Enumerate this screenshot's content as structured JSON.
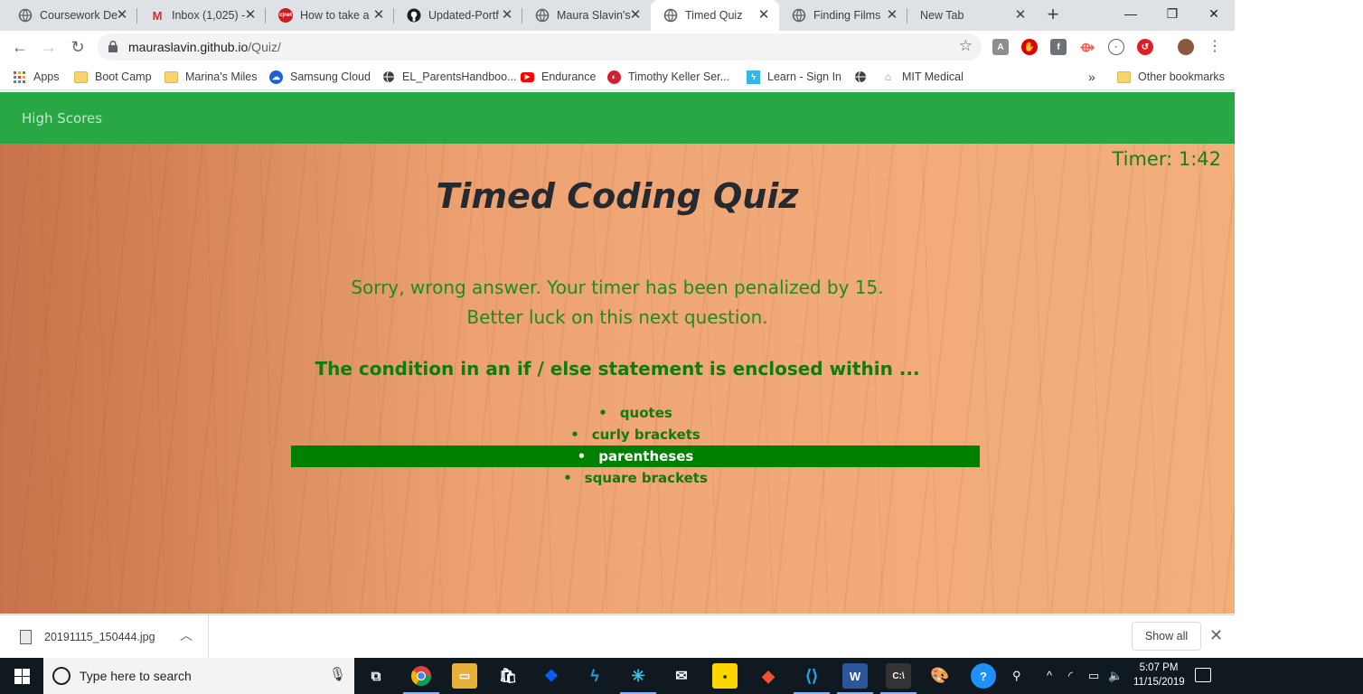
{
  "browser": {
    "tabs": [
      {
        "title": "Coursework De",
        "icon": "globe-icon"
      },
      {
        "title": "Inbox (1,025) -",
        "icon": "gmail-icon"
      },
      {
        "title": "How to take a",
        "icon": "cnet-icon"
      },
      {
        "title": "Updated-Portf",
        "icon": "github-icon"
      },
      {
        "title": "Maura Slavin's",
        "icon": "globe-icon"
      },
      {
        "title": "Timed Quiz",
        "icon": "globe-icon",
        "active": true
      },
      {
        "title": "Finding Films",
        "icon": "globe-icon"
      },
      {
        "title": "New Tab",
        "icon": ""
      }
    ],
    "url_host": "mauraslavin.github.io",
    "url_path": "/Quiz/",
    "bookmarks": [
      {
        "label": "Apps",
        "icon": "apps-grid-icon"
      },
      {
        "label": "Boot Camp",
        "icon": "folder-icon"
      },
      {
        "label": "Marina's Miles",
        "icon": "folder-icon"
      },
      {
        "label": "Samsung Cloud",
        "icon": "samsung-cloud-icon"
      },
      {
        "label": "EL_ParentsHandboo...",
        "icon": "globe-icon"
      },
      {
        "label": "Endurance",
        "icon": "youtube-icon"
      },
      {
        "label": "Timothy Keller Ser...",
        "icon": "gospel-icon"
      },
      {
        "label": "Learn - Sign In",
        "icon": "learn-icon"
      },
      {
        "label": "",
        "icon": "globe-icon"
      },
      {
        "label": "MIT Medical",
        "icon": "mit-icon"
      }
    ],
    "bookmarks_overflow": "»",
    "other_bookmarks": "Other bookmarks"
  },
  "page": {
    "nav_link": "High Scores",
    "timer": "Timer: 1:42",
    "title": "Timed Coding Quiz",
    "feedback": "Sorry, wrong answer. Your timer has been penalized by 15. Better luck on this next question.",
    "question": "The condition in an if / else statement is enclosed within ...",
    "answers": [
      "quotes",
      "curly brackets",
      "parentheses",
      "square brackets"
    ],
    "selected_answer_index": 2,
    "colors": {
      "navbar": "#28a745",
      "selected_answer": "#008000",
      "text_green": "#117a11"
    }
  },
  "downloads": {
    "file": "20191115_150444.jpg",
    "show_all": "Show all"
  },
  "taskbar": {
    "search_placeholder": "Type here to search",
    "time": "5:07 PM",
    "date": "11/15/2019"
  }
}
